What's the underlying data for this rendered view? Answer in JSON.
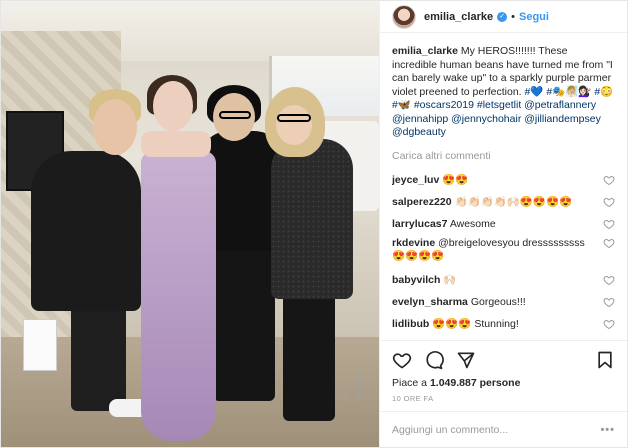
{
  "post": {
    "username": "emilia_clarke",
    "follow_label": "Segui",
    "dot": "•",
    "verified_icon": "verified-badge-icon",
    "caption": {
      "author": "emilia_clarke",
      "text": " My HEROS!!!!!!! These incredible human beans have turned me from \"I can barely wake up\" to a sparkly purple parmer violet preened to perfection. ",
      "tags": "#💙 #🎭🧖🏼‍♀️💇🏻‍♀️ #😳 #🦋 #oscars2019 #letsgetlit @petraflannery @jennahipp @jennychohair @jilliandempsey @dgbeauty"
    },
    "load_more": "Carica altri commenti",
    "comments": [
      {
        "user": "jeyce_luv",
        "text": "😍😍"
      },
      {
        "user": "salperez220",
        "text": "👏🏻👏🏻👏🏻👏🏻🙌🏻😍😍😍😍"
      },
      {
        "user": "larrylucas7",
        "text": "Awesome"
      },
      {
        "user": "rkdevine",
        "text": "@breigelovesyou dresssssssss 😍😍😍😍"
      },
      {
        "user": "babyvilch",
        "text": "🙌🏻"
      },
      {
        "user": "evelyn_sharma",
        "text": "Gorgeous!!!"
      },
      {
        "user": "lidlibub",
        "text": "😍😍😍 Stunning!"
      }
    ],
    "likes_prefix": "Piace a ",
    "likes_count": "1.049.887",
    "likes_suffix": " persone",
    "time": "10 ORE FA",
    "add_comment_placeholder": "Aggiungi un commento...",
    "more_options": "•••",
    "accent_color": "#3897f0"
  }
}
